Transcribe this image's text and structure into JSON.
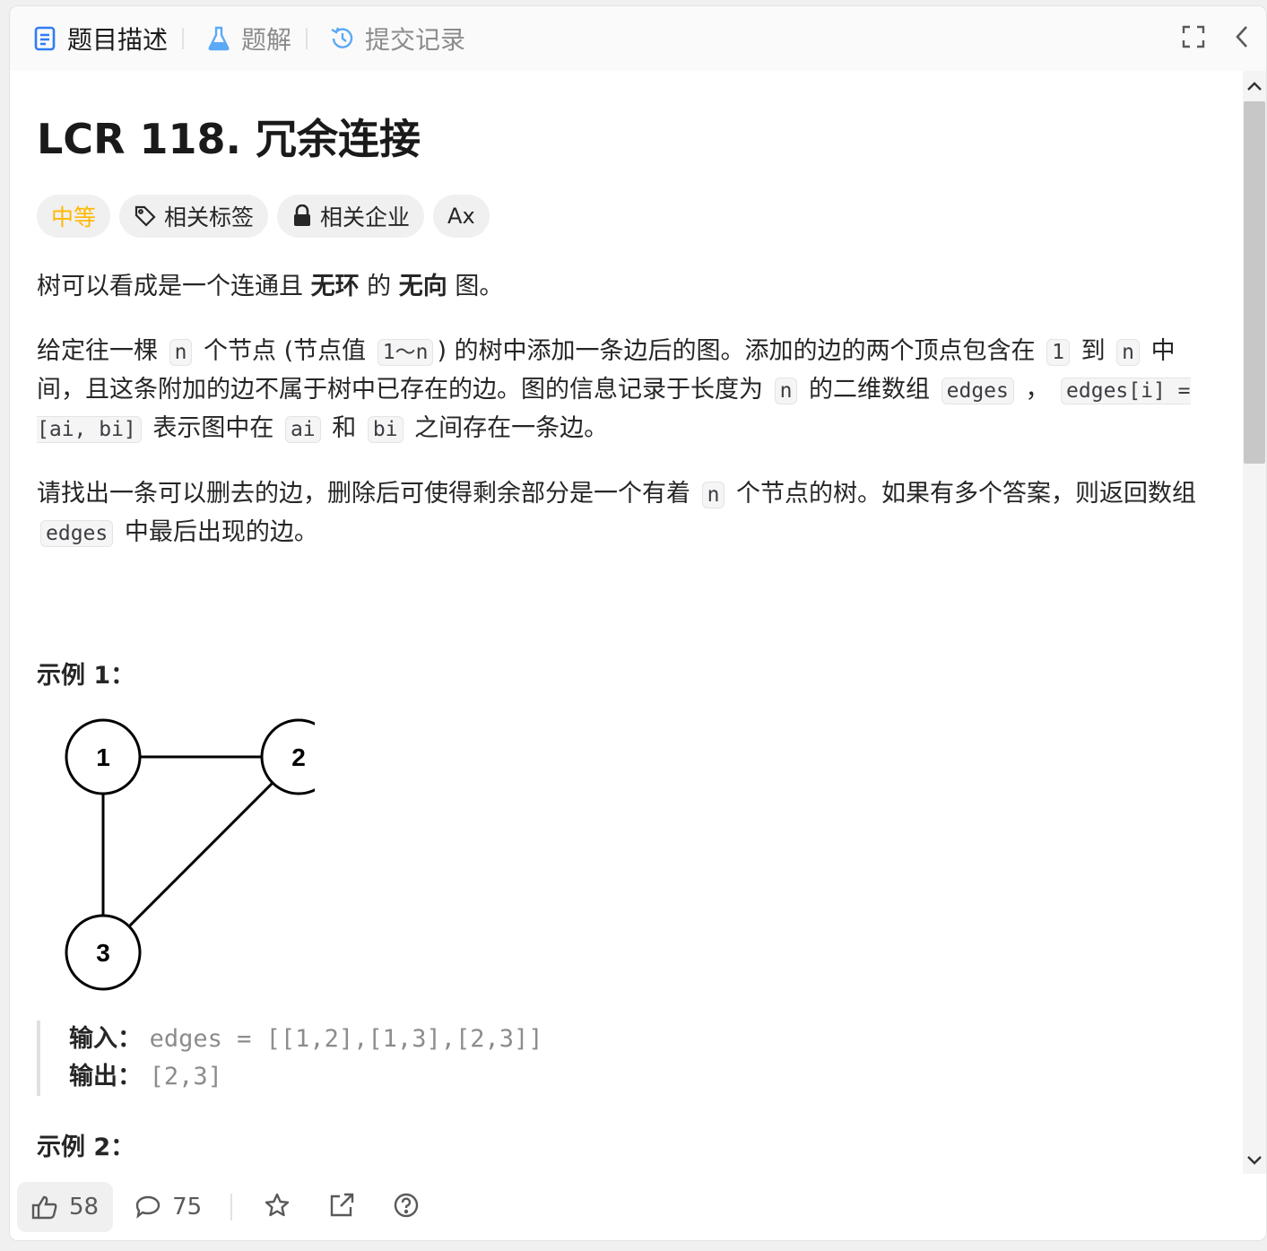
{
  "tabs": [
    {
      "label": "题目描述",
      "icon": "document-icon",
      "active": true
    },
    {
      "label": "题解",
      "icon": "flask-icon",
      "active": false
    },
    {
      "label": "提交记录",
      "icon": "history-icon",
      "active": false
    }
  ],
  "header_actions": [
    "fullscreen-icon",
    "chevron-left-icon"
  ],
  "problem": {
    "title": "LCR 118. 冗余连接",
    "difficulty": "中等",
    "chips": {
      "tags": "相关标签",
      "companies": "相关企业",
      "font": "Ax"
    }
  },
  "description": {
    "p1": {
      "a": "树可以看成是一个连通且 ",
      "b1": "无环",
      "c": " 的 ",
      "b2": "无向",
      "d": " 图。"
    },
    "p2": {
      "t1": "给定往一棵 ",
      "c1": "n",
      "t2": " 个节点 (节点值 ",
      "c2": "1～n",
      "t3": ") 的树中添加一条边后的图。添加的边的两个顶点包含在 ",
      "c3": "1",
      "t4": " 到 ",
      "c4": "n",
      "t5": " 中间，且这条附加的边不属于树中已存在的边。图的信息记录于长度为 ",
      "c5": "n",
      "t6": " 的二维数组 ",
      "c6": "edges",
      "t7": " ， ",
      "c7": "edges[i] = [ai, bi]",
      "t8": " 表示图中在 ",
      "c8": "ai",
      "t9": " 和 ",
      "c9": "bi",
      "t10": " 之间存在一条边。"
    },
    "p3": {
      "t1": "请找出一条可以删去的边，删除后可使得剩余部分是一个有着 ",
      "c1": "n",
      "t2": " 个节点的树。如果有多个答案，则返回数组 ",
      "c2": "edges",
      "t3": " 中最后出现的边。"
    }
  },
  "example1": {
    "title": "示例 1：",
    "graph": {
      "nodes": [
        "1",
        "2",
        "3"
      ],
      "edges": [
        [
          "1",
          "2"
        ],
        [
          "1",
          "3"
        ],
        [
          "2",
          "3"
        ]
      ]
    },
    "input_label": "输入：",
    "input_value": "edges = [[1,2],[1,3],[2,3]]",
    "output_label": "输出：",
    "output_value": "[2,3]"
  },
  "example2": {
    "title": "示例 2："
  },
  "footer": {
    "likes": "58",
    "comments": "75"
  }
}
